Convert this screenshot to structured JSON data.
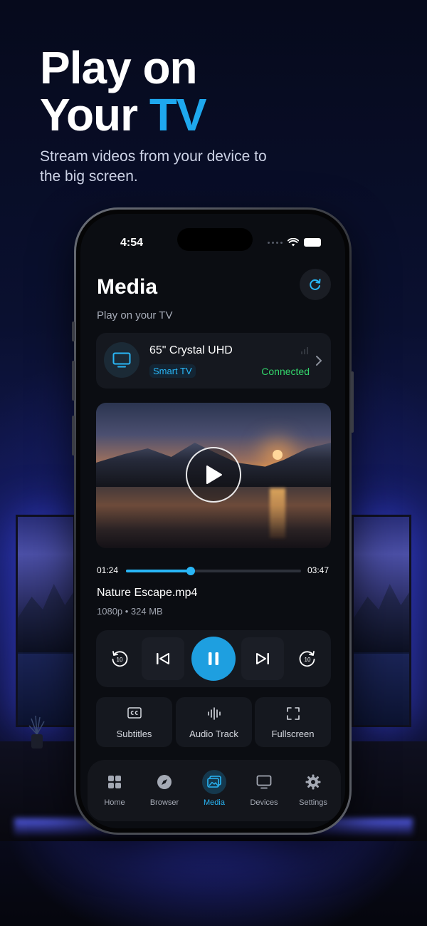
{
  "hero": {
    "title_line1": "Play on",
    "title_line2_plain": "Your ",
    "title_line2_accent": "TV",
    "subtitle": "Stream videos from your device to the big screen."
  },
  "status_bar": {
    "time": "4:54",
    "icons": [
      "cellular-dots-icon",
      "wifi-icon",
      "battery-icon"
    ]
  },
  "header": {
    "title": "Media",
    "subtitle": "Play on your TV",
    "refresh_icon": "refresh-icon"
  },
  "device": {
    "name": "65\" Crystal UHD",
    "type": "Smart TV",
    "status": "Connected",
    "icon": "tv-icon"
  },
  "player": {
    "current_time": "01:24",
    "total_time": "03:47",
    "progress_fraction": 0.37,
    "file_name": "Nature Escape.mp4",
    "file_meta": "1080p • 324 MB",
    "rewind_label": "10",
    "forward_label": "10"
  },
  "options": [
    {
      "label": "Subtitles",
      "icon": "cc-icon"
    },
    {
      "label": "Audio Track",
      "icon": "waveform-icon"
    },
    {
      "label": "Fullscreen",
      "icon": "fullscreen-icon"
    }
  ],
  "tabs": [
    {
      "label": "Home",
      "icon": "grid-icon"
    },
    {
      "label": "Browser",
      "icon": "compass-icon"
    },
    {
      "label": "Media",
      "icon": "image-icon",
      "active": true
    },
    {
      "label": "Devices",
      "icon": "monitor-icon"
    },
    {
      "label": "Settings",
      "icon": "gear-icon"
    }
  ],
  "colors": {
    "accent": "#29b6f6",
    "connected": "#33d46b",
    "background": "#0b0d12",
    "card": "#15181f"
  }
}
